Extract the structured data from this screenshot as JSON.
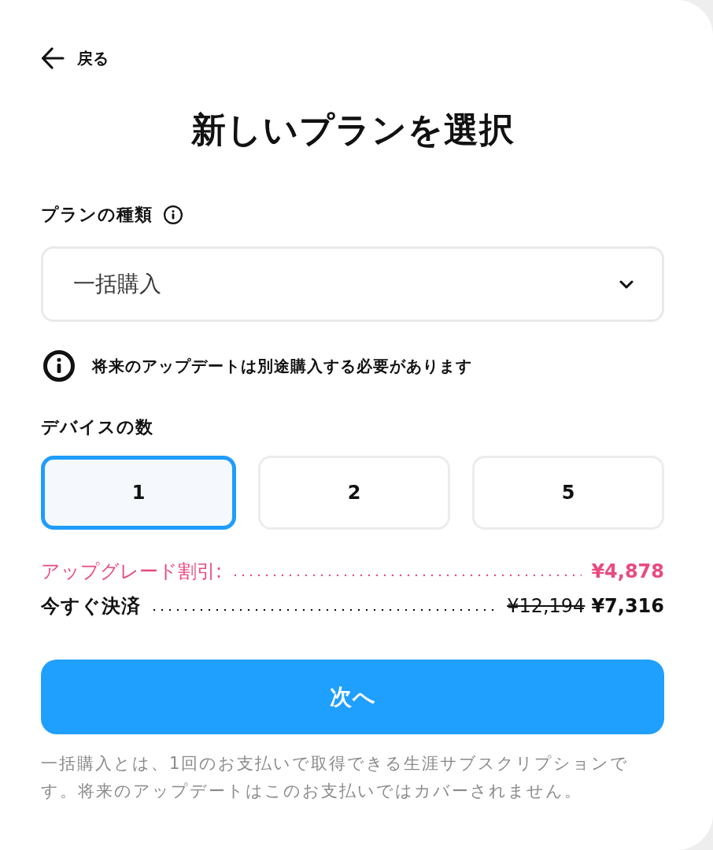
{
  "back_link": {
    "label": "戻る"
  },
  "title": "新しいプランを選択",
  "plan_type": {
    "label": "プランの種類",
    "value": "一括購入"
  },
  "notice": "将来のアップデートは別途購入する必要があります",
  "devices": {
    "label": "デバイスの数",
    "options": [
      {
        "label": "1",
        "selected": true
      },
      {
        "label": "2",
        "selected": false
      },
      {
        "label": "5",
        "selected": false
      }
    ]
  },
  "summary": [
    {
      "kind": "discount",
      "label": "アップグレード割引:",
      "prices": [
        {
          "text": "¥4,878",
          "struck": false
        }
      ]
    },
    {
      "kind": "total",
      "label": "今すぐ決済",
      "prices": [
        {
          "text": "¥12,194",
          "struck": true
        },
        {
          "text": "¥7,316",
          "struck": false
        }
      ]
    }
  ],
  "next_button": {
    "label": "次へ"
  },
  "footnote": "一括購入とは、1回のお支払いで取得できる生涯サブスクリプションです。将来のアップデートはこのお支払いではカバーされません。"
}
